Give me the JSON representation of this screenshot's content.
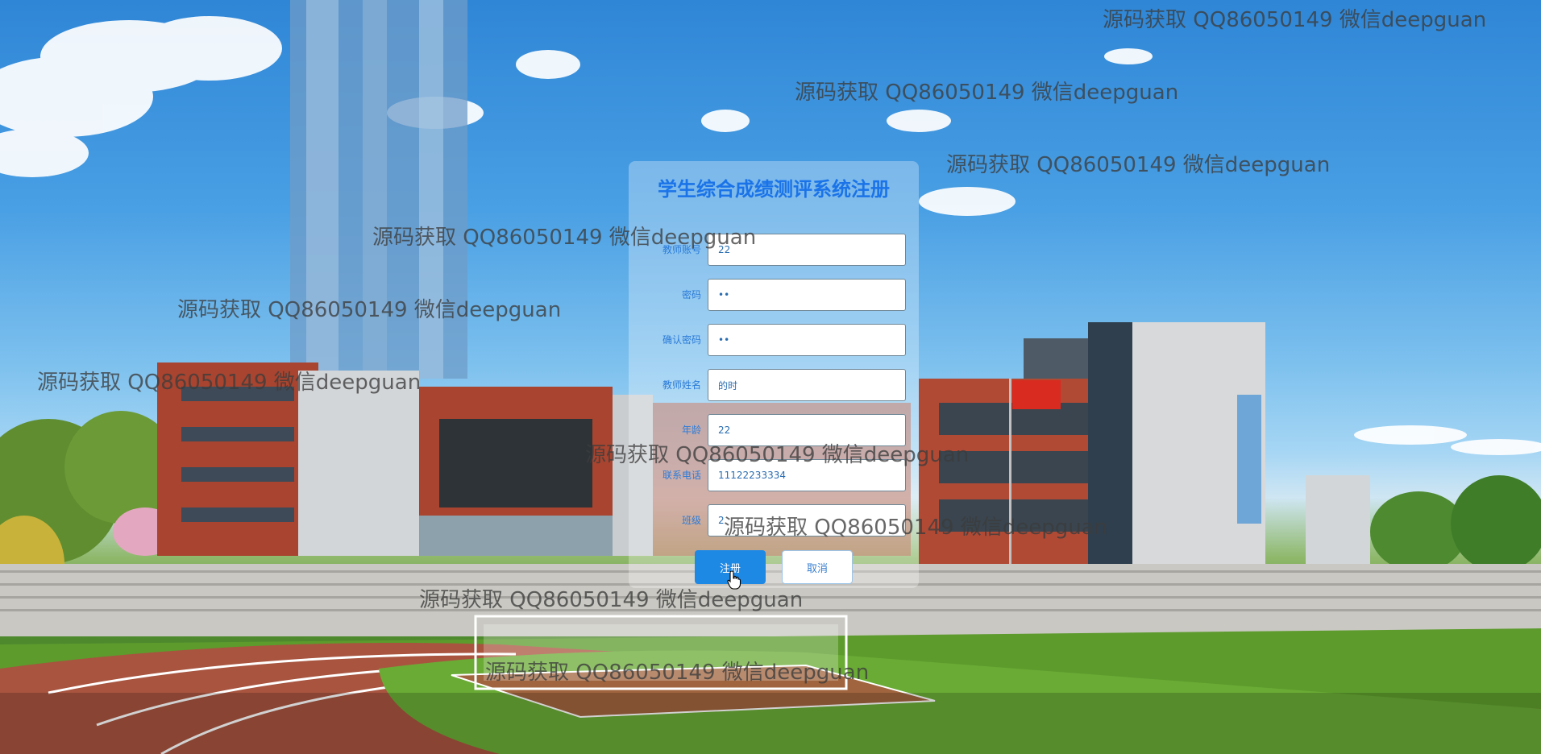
{
  "form": {
    "title": "学生综合成绩测评系统注册",
    "fields": [
      {
        "label": "教师账号",
        "value": "22"
      },
      {
        "label": "密码",
        "value": "••"
      },
      {
        "label": "确认密码",
        "value": "••"
      },
      {
        "label": "教师姓名",
        "value": "的时"
      },
      {
        "label": "年龄",
        "value": "22"
      },
      {
        "label": "联系电话",
        "value": "11122233334"
      },
      {
        "label": "班级",
        "value": "2"
      }
    ],
    "register_label": "注册",
    "cancel_label": "取消"
  },
  "watermark": {
    "text": "源码获取 QQ86050149 微信deepguan",
    "color": "#3c3c3c"
  },
  "colors": {
    "accent": "#1e88e5",
    "title": "#1a73e8"
  },
  "icons": {
    "cursor": "hand-pointer-icon",
    "flag": "china-flag"
  }
}
